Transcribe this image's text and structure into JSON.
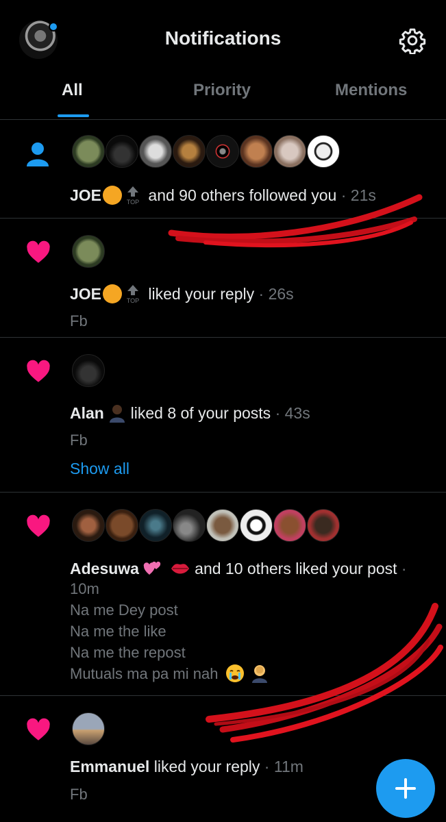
{
  "header": {
    "title": "Notifications",
    "profile_icon": "user-avatar",
    "settings_icon": "gear-icon"
  },
  "tabs": [
    {
      "label": "All",
      "active": true
    },
    {
      "label": "Priority",
      "active": false
    },
    {
      "label": "Mentions",
      "active": false
    }
  ],
  "notifications": [
    {
      "type": "follow",
      "icon": "person-icon",
      "name": "JOE",
      "text": "and 90 others followed you",
      "separator": " · ",
      "time": "21s",
      "avatar_count": 8
    },
    {
      "type": "like",
      "icon": "heart-icon",
      "name": "JOE",
      "text": "liked your reply",
      "separator": " · ",
      "time": "26s",
      "sub": "Fb"
    },
    {
      "type": "like",
      "icon": "heart-icon",
      "name": "Alan",
      "text": "liked 8 of your posts",
      "separator": " · ",
      "time": "43s",
      "sub": "Fb",
      "link": "Show all"
    },
    {
      "type": "like",
      "icon": "heart-icon",
      "name": "Adesuwa",
      "text": "and 10 others liked your post",
      "separator": " ·",
      "time": "10m",
      "sub_lines": [
        "Na me Dey post",
        "Na me the like",
        "Na me the repost",
        "Mutuals ma pa mi nah"
      ],
      "avatar_count": 8
    },
    {
      "type": "like",
      "icon": "heart-icon",
      "name": "Emmanuel",
      "text": "liked your reply",
      "separator": " · ",
      "time": "11m",
      "sub": "Fb"
    }
  ],
  "badges": {
    "top_label": "TOP"
  },
  "fab": {
    "icon": "plus-icon"
  },
  "colors": {
    "accent": "#1d9bf0",
    "like": "#f91880",
    "background": "#000000",
    "muted": "#71767b"
  }
}
